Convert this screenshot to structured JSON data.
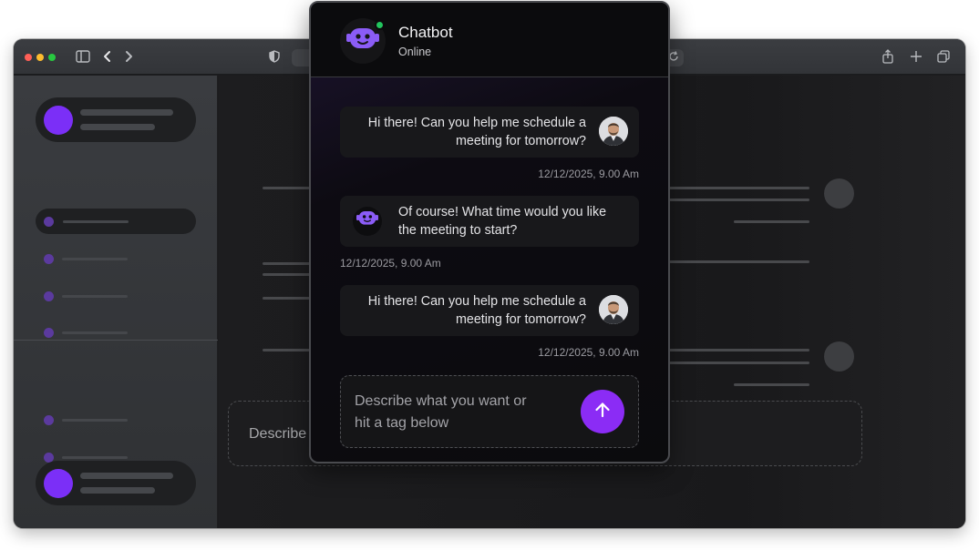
{
  "chatbot": {
    "title": "Chatbot",
    "status": "Online",
    "messages": [
      {
        "sender": "user",
        "text": "Hi there! Can you help me schedule a meeting for tomorrow?",
        "line1": "Hi there! Can you help me schedule a",
        "line2": "meeting for tomorrow?",
        "time": "12/12/2025, 9.00 Am"
      },
      {
        "sender": "bot",
        "text": "Of course! What time would you like the meeting to start?",
        "line1": "Of course! What time would you like",
        "line2": "the meeting to start?",
        "time": "12/12/2025, 9.00 Am"
      },
      {
        "sender": "user",
        "text": "Hi there! Can you help me schedule a meeting for tomorrow?",
        "line1": "Hi there! Can you help me schedule a",
        "line2": "meeting for tomorrow?",
        "time": "12/12/2025, 9.00 Am"
      }
    ],
    "input": {
      "placeholder": "Describe what you want or hit a tag below",
      "placeholder_line1": "Describe what you want or",
      "placeholder_line2": "hit a tag below"
    }
  },
  "background_app": {
    "input_placeholder": "Describe what you want or hit a tag below"
  },
  "colors": {
    "accent": "#8b2cf5",
    "online": "#22c55e"
  },
  "icons": [
    "sidebar-toggle-icon",
    "back-icon",
    "forward-icon",
    "shield-icon",
    "reload-icon",
    "share-icon",
    "new-tab-icon",
    "tabs-icon",
    "bot-icon",
    "send-arrow-icon"
  ]
}
